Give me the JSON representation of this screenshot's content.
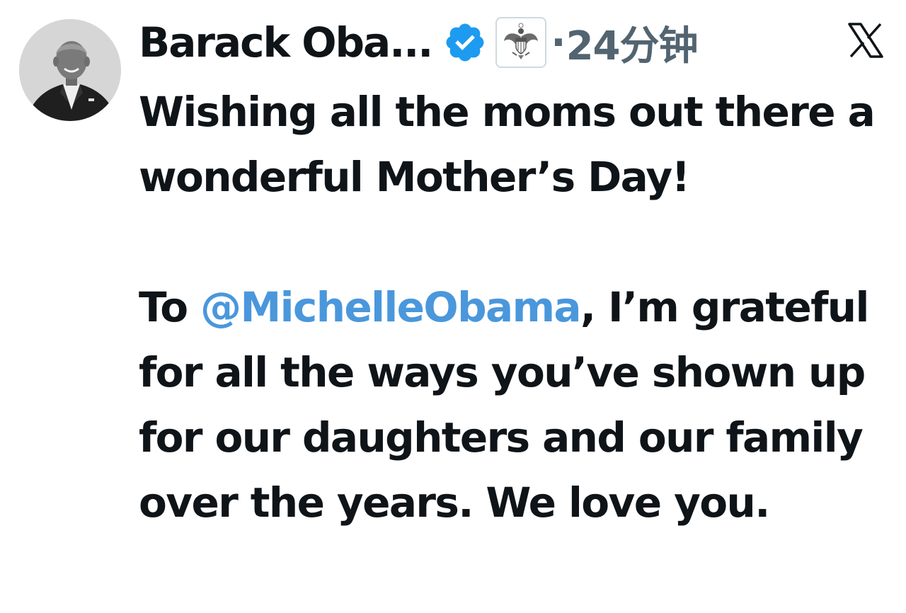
{
  "tweet": {
    "author": {
      "display_name": "Barack Oba...",
      "verified_icon": "verified-badge-icon",
      "affiliate_icon": "us-seal-icon"
    },
    "separator": "·",
    "timestamp": "24分钟",
    "platform_icon": "x-logo-icon",
    "text": {
      "line1": "Wishing all the moms out there a wonderful Mother’s Day!",
      "p2_before": "To ",
      "mention": "@MichelleObama",
      "p2_after": ", I’m grateful for all the ways you’ve shown up for our daughters and our family over the years. We love you."
    }
  },
  "colors": {
    "text": "#0f1419",
    "muted": "#536471",
    "mention": "#4a97dc",
    "verified": "#1d9bf0"
  }
}
